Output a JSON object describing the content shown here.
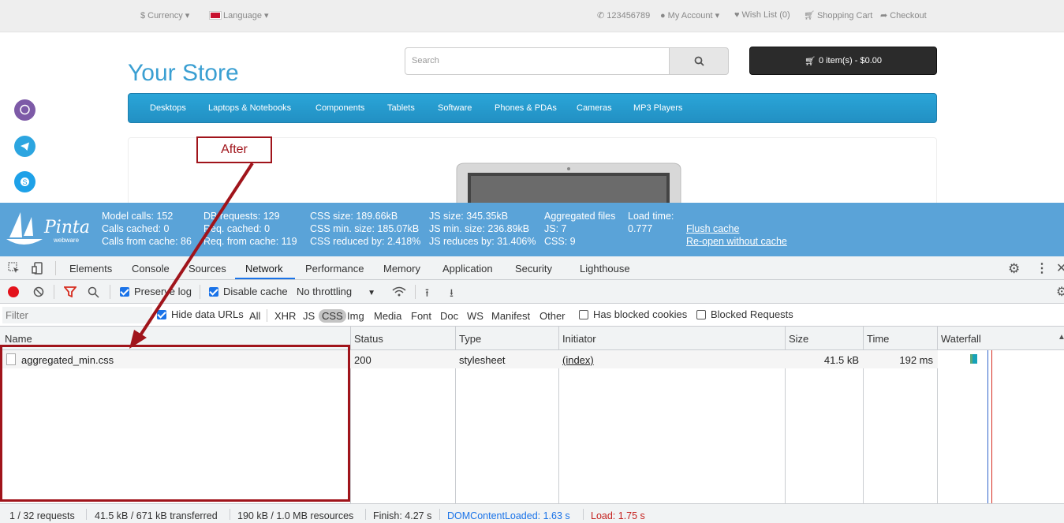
{
  "store": {
    "currency": "Currency",
    "language": "Language",
    "phone": "123456789",
    "my_account": "My Account",
    "wish_list": "Wish List (0)",
    "shopping_cart": "Shopping Cart",
    "checkout": "Checkout",
    "logo": "Your Store",
    "search_placeholder": "Search",
    "cart_label": "0 item(s) - $0.00",
    "menu": [
      "Desktops",
      "Laptops & Notebooks",
      "Components",
      "Tablets",
      "Software",
      "Phones & PDAs",
      "Cameras",
      "MP3 Players"
    ]
  },
  "annotation": {
    "label": "After",
    "color": "#a0141b"
  },
  "profiler": {
    "logo_text": "Pinta",
    "logo_sub": "webware",
    "model_calls": "Model calls: 152",
    "calls_cached": "Calls cached: 0",
    "calls_from_cache": "Calls from cache: 86",
    "db_requests": "DB requests: 129",
    "req_cached": "Req. cached: 0",
    "req_from_cache": "Req. from cache: 119",
    "css_size": "CSS size: 189.66kB",
    "css_min_size": "CSS min. size: 185.07kB",
    "css_reduced": "CSS reduced by: 2.418%",
    "js_size": "JS size: 345.35kB",
    "js_min_size": "JS min. size: 236.89kB",
    "js_reduces": "JS reduces by: 31.406%",
    "aggregated_files": "Aggregated files",
    "agg_js": "JS: 7",
    "agg_css": "CSS: 9",
    "load_time_label": "Load time:",
    "load_time_value": "0.777",
    "flush_cache": "Flush cache",
    "reopen": "Re-open without cache"
  },
  "devtools": {
    "tabs": [
      "Elements",
      "Console",
      "Sources",
      "Network",
      "Performance",
      "Memory",
      "Application",
      "Security",
      "Lighthouse"
    ],
    "active_tab": "Network",
    "preserve_log": "Preserve log",
    "disable_cache": "Disable cache",
    "throttling": "No throttling",
    "filter_placeholder": "Filter",
    "hide_data_urls": "Hide data URLs",
    "types": [
      "All",
      "XHR",
      "JS",
      "CSS",
      "Img",
      "Media",
      "Font",
      "Doc",
      "WS",
      "Manifest",
      "Other"
    ],
    "active_type": "CSS",
    "has_blocked_cookies": "Has blocked cookies",
    "blocked_requests": "Blocked Requests",
    "columns": [
      "Name",
      "Status",
      "Type",
      "Initiator",
      "Size",
      "Time",
      "Waterfall"
    ],
    "rows": [
      {
        "name": "aggregated_min.css",
        "status": "200",
        "type": "stylesheet",
        "initiator": "(index)",
        "size": "41.5 kB",
        "time": "192 ms"
      }
    ],
    "status_bar": {
      "requests": "1 / 32 requests",
      "transferred": "41.5 kB / 671 kB transferred",
      "resources": "190 kB / 1.0 MB resources",
      "finish": "Finish: 4.27 s",
      "dom_loaded": "DOMContentLoaded: 1.63 s",
      "load": "Load: 1.75 s"
    },
    "colors": {
      "accent": "#1a73e8",
      "dom_loaded": "#1a73e8",
      "load": "#c5221f"
    }
  }
}
